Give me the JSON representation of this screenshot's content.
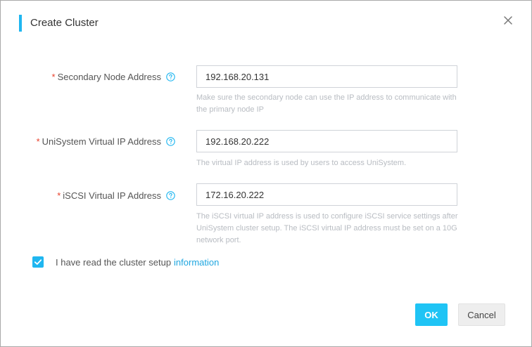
{
  "dialog": {
    "title": "Create Cluster"
  },
  "form": {
    "required_mark": "*",
    "secondary_node": {
      "label": "Secondary Node Address",
      "value": "192.168.20.131",
      "hint": "Make sure the secondary node can use the IP address to communicate with the primary node IP"
    },
    "unisystem_vip": {
      "label": "UniSystem Virtual IP Address",
      "value": "192.168.20.222",
      "hint": "The virtual IP address is used by users to access UniSystem."
    },
    "iscsi_vip": {
      "label": "iSCSI Virtual IP Address",
      "value": "172.16.20.222",
      "hint": "The iSCSI virtual IP address is used to configure iSCSI service settings after UniSystem cluster setup. The iSCSI virtual IP address must be set on a 10G network port."
    }
  },
  "agreement": {
    "checked": true,
    "text": "I have read the cluster setup",
    "link": "information"
  },
  "buttons": {
    "ok": "OK",
    "cancel": "Cancel"
  },
  "colors": {
    "accent": "#1fb6f0",
    "required": "#e8412c",
    "link": "#1fa6e0",
    "hint": "#b8bcc2"
  },
  "icons": {
    "close": "close-icon",
    "help": "help-circle-icon",
    "check": "check-icon"
  }
}
